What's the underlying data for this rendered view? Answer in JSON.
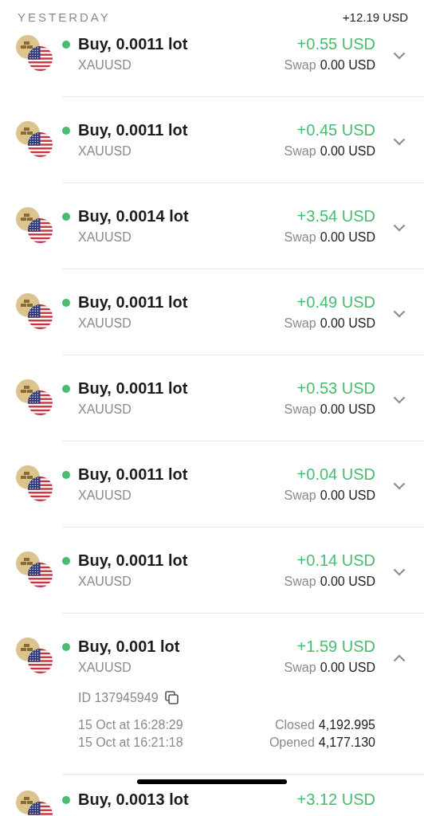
{
  "header": {
    "title": "YESTERDAY",
    "total": "+12.19 USD"
  },
  "trades": [
    {
      "title": "Buy, 0.0011 lot",
      "symbol": "XAUUSD",
      "profit": "+0.55 USD",
      "swap_label": "Swap",
      "swap": "0.00 USD",
      "expanded": false
    },
    {
      "title": "Buy, 0.0011 lot",
      "symbol": "XAUUSD",
      "profit": "+0.45 USD",
      "swap_label": "Swap",
      "swap": "0.00 USD",
      "expanded": false
    },
    {
      "title": "Buy, 0.0014 lot",
      "symbol": "XAUUSD",
      "profit": "+3.54 USD",
      "swap_label": "Swap",
      "swap": "0.00 USD",
      "expanded": false
    },
    {
      "title": "Buy, 0.0011 lot",
      "symbol": "XAUUSD",
      "profit": "+0.49 USD",
      "swap_label": "Swap",
      "swap": "0.00 USD",
      "expanded": false
    },
    {
      "title": "Buy, 0.0011 lot",
      "symbol": "XAUUSD",
      "profit": "+0.53 USD",
      "swap_label": "Swap",
      "swap": "0.00 USD",
      "expanded": false
    },
    {
      "title": "Buy, 0.0011 lot",
      "symbol": "XAUUSD",
      "profit": "+0.04 USD",
      "swap_label": "Swap",
      "swap": "0.00 USD",
      "expanded": false
    },
    {
      "title": "Buy, 0.0011 lot",
      "symbol": "XAUUSD",
      "profit": "+0.14 USD",
      "swap_label": "Swap",
      "swap": "0.00 USD",
      "expanded": false
    },
    {
      "title": "Buy, 0.001 lot",
      "symbol": "XAUUSD",
      "profit": "+1.59 USD",
      "swap_label": "Swap",
      "swap": "0.00 USD",
      "expanded": true,
      "details": {
        "id": "ID 137945949",
        "closed_time": "15 Oct at 16:28:29",
        "closed_label": "Closed",
        "closed_price": "4,192.995",
        "opened_time": "15 Oct at 16:21:18",
        "opened_label": "Opened",
        "opened_price": "4,177.130"
      }
    },
    {
      "title": "Buy, 0.0013 lot",
      "profit": "+3.12 USD"
    }
  ]
}
